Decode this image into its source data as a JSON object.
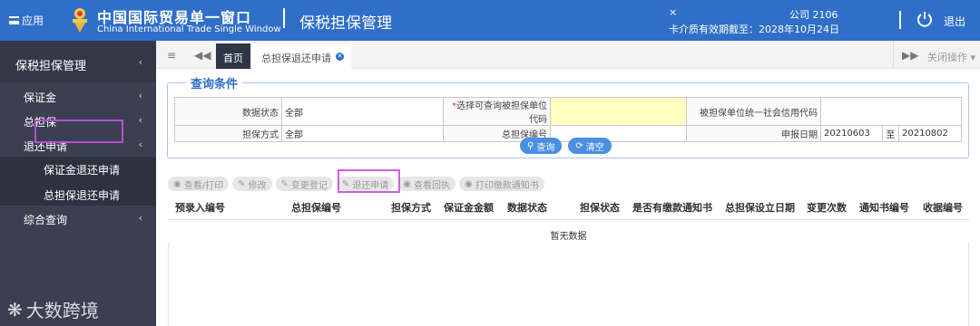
{
  "header": {
    "menu_label": "应用",
    "brand_cn": "中国国际贸易单一窗口",
    "brand_en": "China International Trade Single Window",
    "system_title": "保税担保管理",
    "user_name": "×",
    "company": "公司 2106",
    "card_valid": "卡介质有效期截至：2028年10月24日",
    "logout_label": "退出"
  },
  "sidebar": {
    "title": "保税担保管理",
    "items": [
      {
        "label": "保证金"
      },
      {
        "label": "总担保"
      },
      {
        "label": "退还申请"
      },
      {
        "label": "综合查询"
      }
    ],
    "sub_items": [
      {
        "label": "保证金退还申请"
      },
      {
        "label": "总担保退还申请"
      }
    ],
    "watermark": "大数跨境"
  },
  "tabs": {
    "home": "首页",
    "active": "总担保退还申请",
    "close_ops": "关闭操作"
  },
  "query": {
    "legend": "查询条件",
    "rows": [
      {
        "l1": "数据状态",
        "v1": "全部",
        "l2": "选择可查询被担保单位代码",
        "v2": "",
        "l3": "被担保单位统一社会信用代码",
        "v3": ""
      },
      {
        "l1": "担保方式",
        "v1": "全部",
        "l2": "总担保编号",
        "v2": "",
        "l3": "申报日期",
        "v3a": "20210603",
        "sep": "至",
        "v3b": "20210802"
      }
    ],
    "search_btn": "查询",
    "clear_btn": "清空"
  },
  "toolbar": {
    "buttons": [
      "查看/打印",
      "修改",
      "变更登记",
      "退还申请",
      "查看回执",
      "打印缴款通知书"
    ]
  },
  "results": {
    "columns": [
      "预录入编号",
      "总担保编号",
      "担保方式",
      "保证金金额",
      "数据状态",
      "担保状态",
      "是否有缴款通知书",
      "总担保设立日期",
      "变更次数",
      "通知书编号",
      "收据编号"
    ],
    "empty": "暂无数据"
  }
}
